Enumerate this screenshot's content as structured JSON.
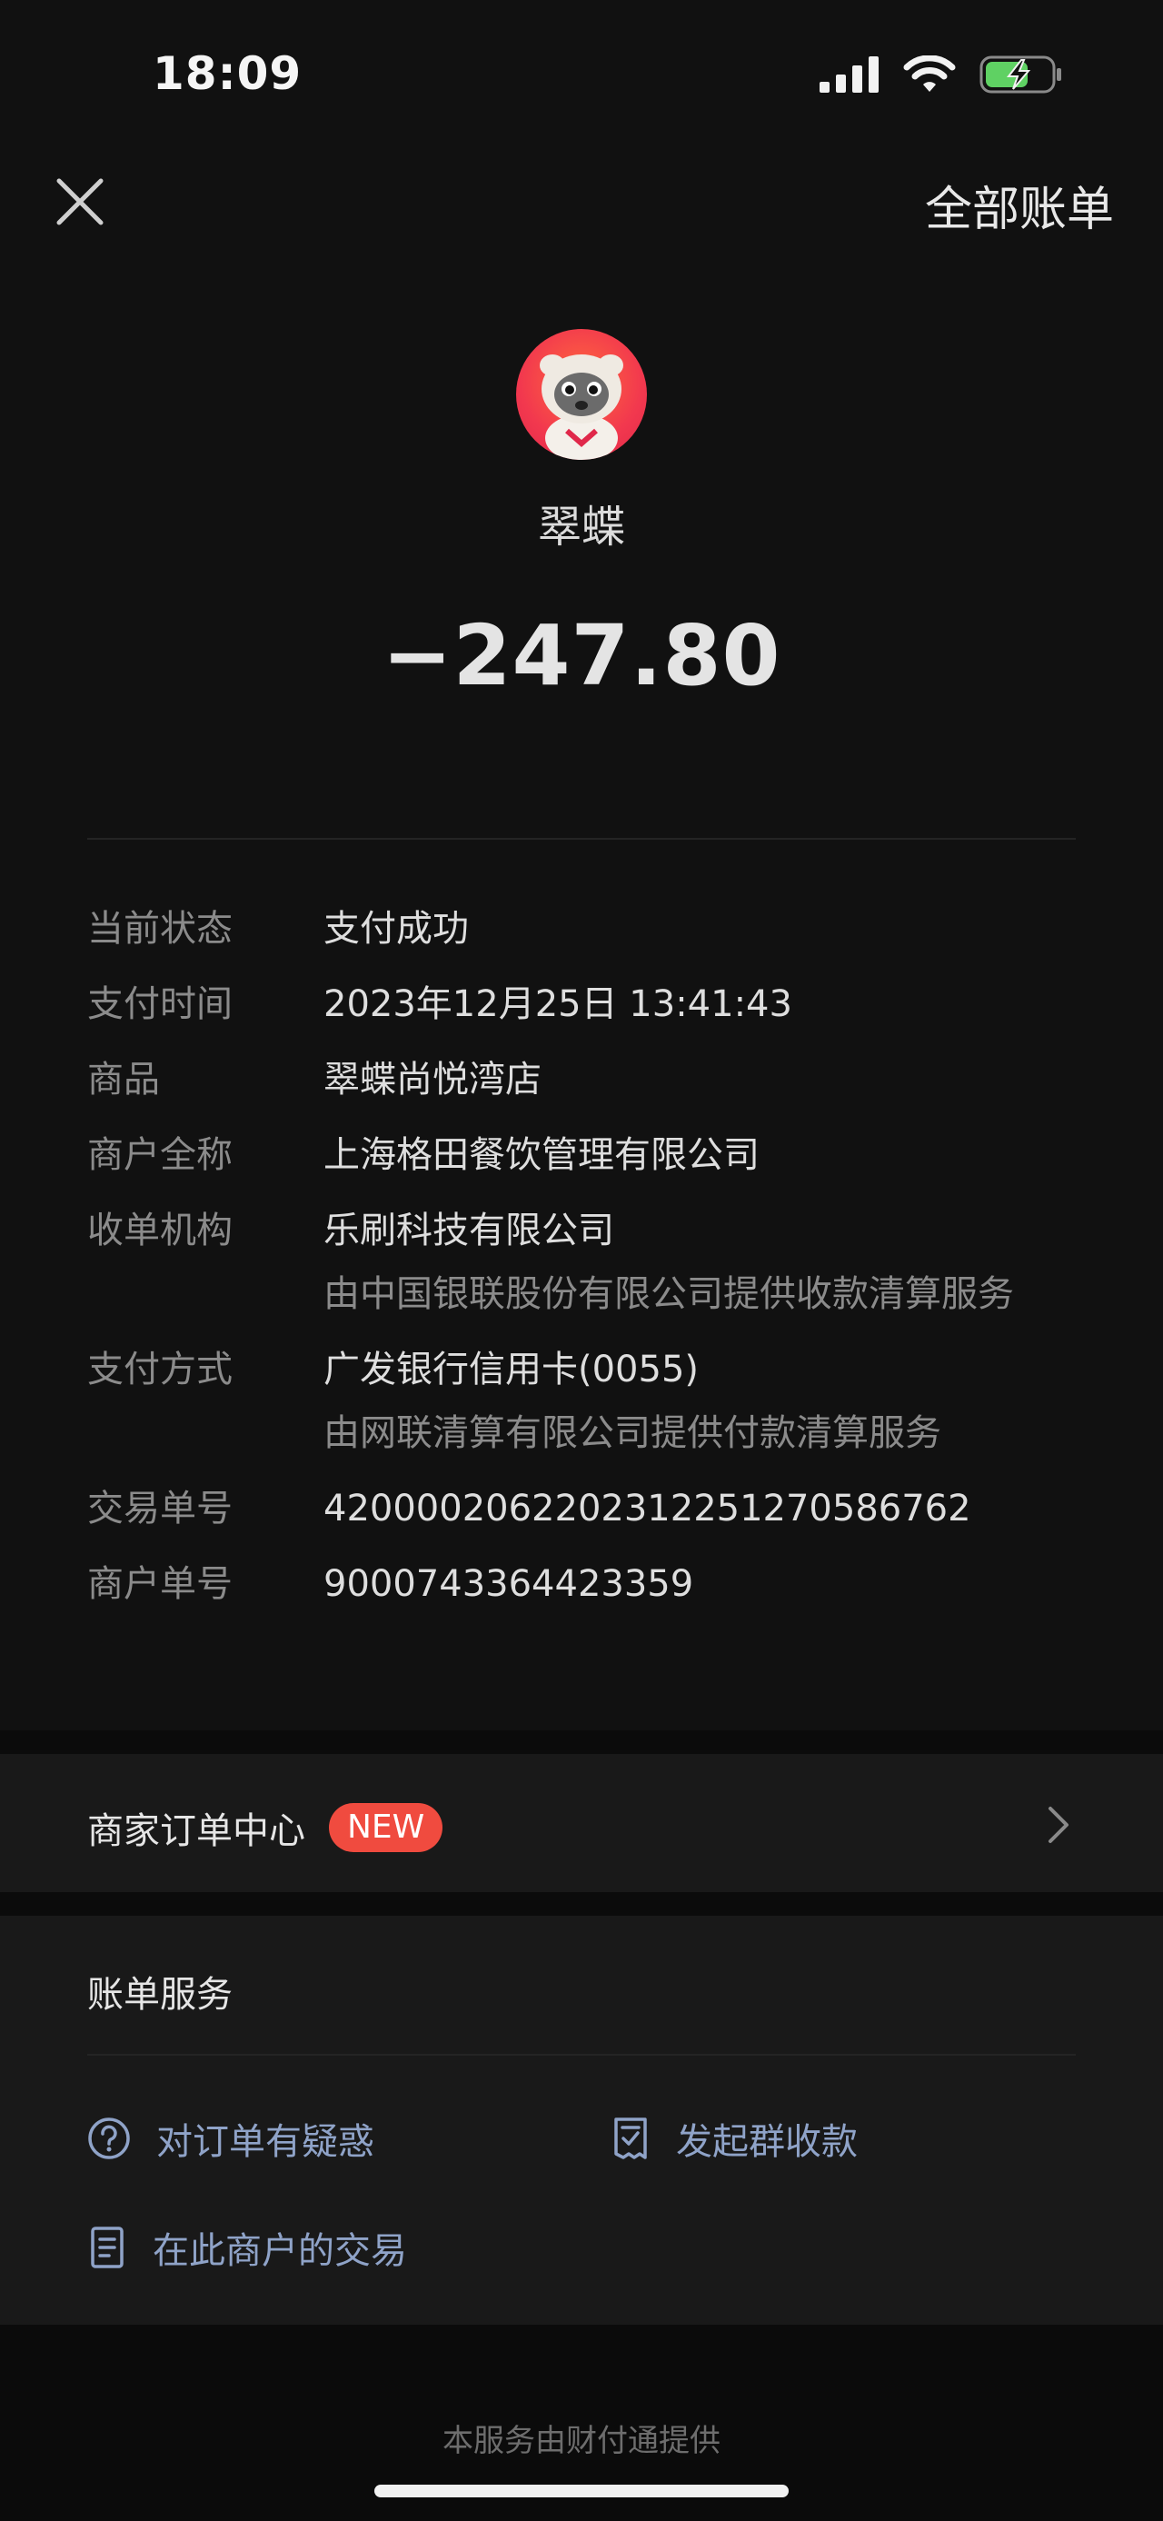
{
  "status_bar": {
    "time": "18:09"
  },
  "header": {
    "all_bills_label": "全部账单"
  },
  "merchant": {
    "name": "翠蝶",
    "amount": "−247.80"
  },
  "details": [
    {
      "label": "当前状态",
      "value": "支付成功",
      "sub": ""
    },
    {
      "label": "支付时间",
      "value": "2023年12月25日 13:41:43",
      "sub": ""
    },
    {
      "label": "商品",
      "value": "翠蝶尚悦湾店",
      "sub": ""
    },
    {
      "label": "商户全称",
      "value": "上海格田餐饮管理有限公司",
      "sub": ""
    },
    {
      "label": "收单机构",
      "value": "乐刷科技有限公司",
      "sub": "由中国银联股份有限公司提供收款清算服务"
    },
    {
      "label": "支付方式",
      "value": "广发银行信用卡(0055)",
      "sub": "由网联清算有限公司提供付款清算服务"
    },
    {
      "label": "交易单号",
      "value": "4200002062202312251270586762",
      "sub": ""
    },
    {
      "label": "商户单号",
      "value": "9000743364423359",
      "sub": ""
    }
  ],
  "order_center": {
    "label": "商家订单中心",
    "badge": "NEW"
  },
  "services": {
    "title": "账单服务",
    "items": [
      {
        "label": "对订单有疑惑",
        "icon": "question-circle-icon"
      },
      {
        "label": "发起群收款",
        "icon": "receipt-icon"
      },
      {
        "label": "在此商户的交易",
        "icon": "document-icon"
      }
    ]
  },
  "footer": {
    "text": "本服务由财付通提供"
  },
  "colors": {
    "background": "#111111",
    "card": "#191919",
    "badge": "#f04b3f",
    "link": "#8fa3c8"
  }
}
